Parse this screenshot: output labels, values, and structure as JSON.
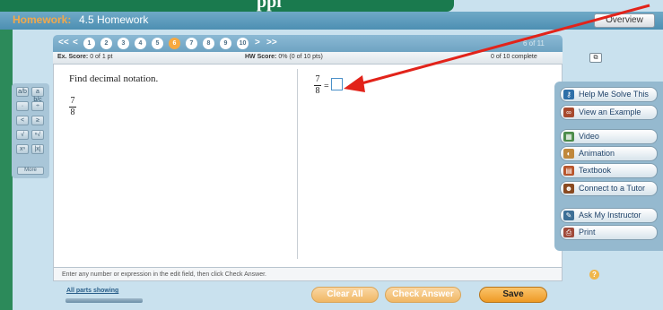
{
  "header": {
    "banner_text": "ppl",
    "homework_label": "Homework:",
    "assignment_title": "4.5 Homework",
    "overview_label": "Overview"
  },
  "nav": {
    "first": "<<",
    "prev": "<",
    "next": ">",
    "last": ">>",
    "question_numbers": [
      "1",
      "2",
      "3",
      "4",
      "5",
      "6",
      "7",
      "8",
      "9",
      "10"
    ],
    "active_question": "6",
    "page_indicator": "6 of 11"
  },
  "scores": {
    "ex_label": "Ex. Score:",
    "ex_value": "0 of 1 pt",
    "hw_label": "HW Score:",
    "hw_value": "0% (0 of 10 pts)",
    "complete": "0 of 10 complete"
  },
  "question": {
    "instruction": "Find decimal notation.",
    "numerator": "7",
    "denominator": "8",
    "equals": "="
  },
  "footer": {
    "hint": "Enter any number or expression in the edit field, then click Check Answer.",
    "help_icon": "?"
  },
  "actions": {
    "parts_label": "All parts showing",
    "clear_all": "Clear All",
    "check_answer": "Check Answer",
    "save": "Save"
  },
  "tools": {
    "keys": [
      "a/b",
      "a b/c",
      "·",
      "÷",
      "<",
      "≥",
      "√",
      "ⁿ√",
      "xⁿ",
      "|x|"
    ],
    "more": "More"
  },
  "resources": [
    {
      "label": "Help Me Solve This",
      "icon": "key-icon",
      "color": "#2e6fa8"
    },
    {
      "label": "View an Example",
      "icon": "binoculars-icon",
      "color": "#a7492d"
    },
    {
      "label": "Video",
      "icon": "film-icon",
      "color": "#4c8c4a"
    },
    {
      "label": "Animation",
      "icon": "animation-icon",
      "color": "#c0883c"
    },
    {
      "label": "Textbook",
      "icon": "book-icon",
      "color": "#b8542a"
    },
    {
      "label": "Connect to a Tutor",
      "icon": "tutor-icon",
      "color": "#8a4a20"
    },
    {
      "label": "Ask My Instructor",
      "icon": "instructor-icon",
      "color": "#3d6f96"
    },
    {
      "label": "Print",
      "icon": "printer-icon",
      "color": "#a04a3a"
    }
  ]
}
